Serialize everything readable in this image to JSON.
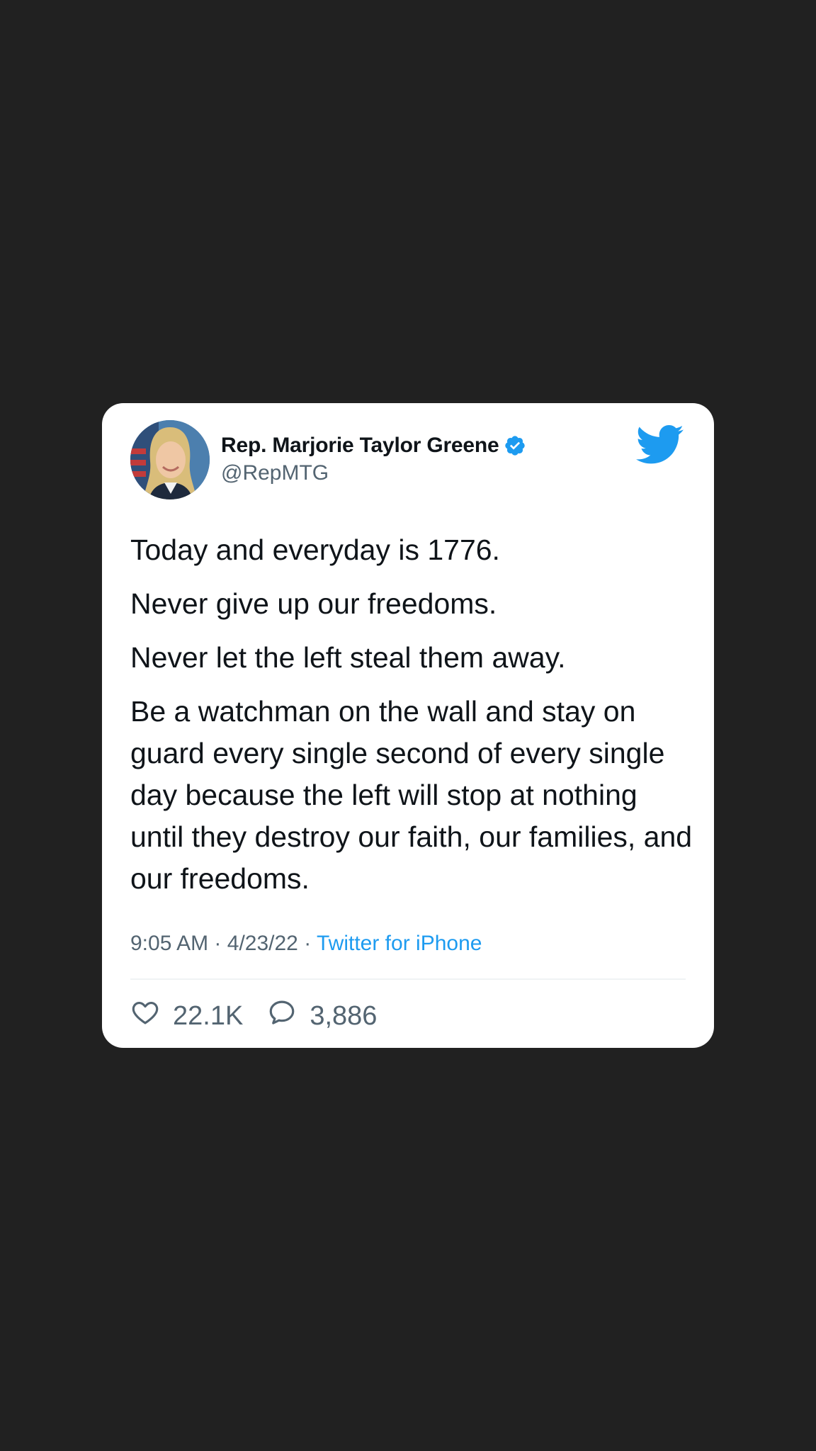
{
  "tweet": {
    "display_name": "Rep. Marjorie Taylor Greene",
    "handle": "@RepMTG",
    "paragraphs": [
      "Today and everyday is 1776.",
      "Never give up our freedoms.",
      "Never let the left steal them away.",
      "Be a watchman on the wall and stay on guard every single second of every single day because the left will stop at nothing until they destroy our faith, our families, and our freedoms."
    ],
    "time": "9:05 AM",
    "date": "4/23/22",
    "separator": "·",
    "source": "Twitter for iPhone",
    "likes": "22.1K",
    "replies": "3,886"
  },
  "icons": {
    "verified": "verified-badge-icon",
    "bird": "twitter-bird-icon",
    "like": "heart-icon",
    "reply": "speech-bubble-icon"
  },
  "colors": {
    "background": "#212121",
    "card": "#ffffff",
    "accent": "#1d9bf0",
    "text": "#0f1419",
    "secondary": "#536471"
  }
}
